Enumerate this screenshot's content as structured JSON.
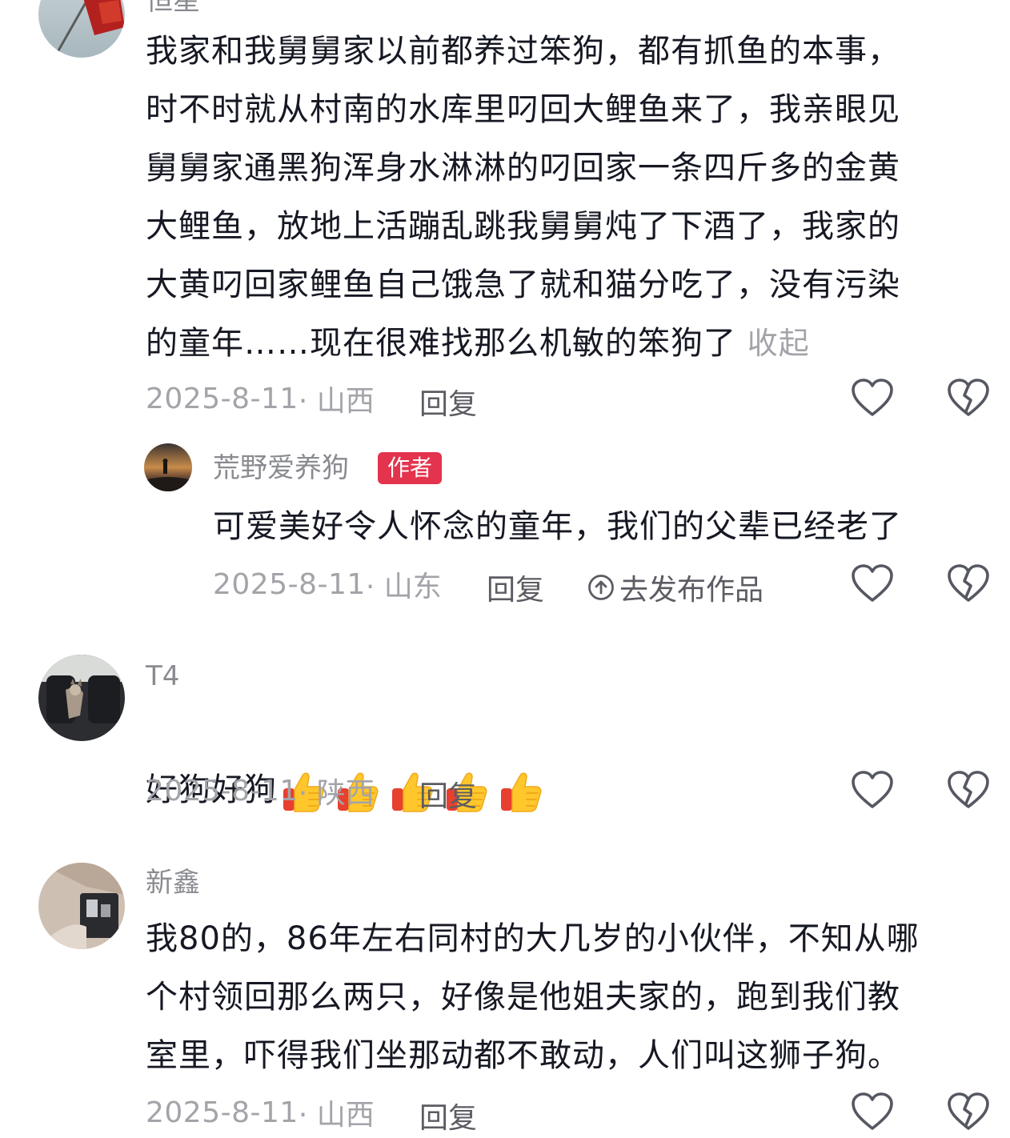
{
  "comments": [
    {
      "username": "恒星",
      "content": "我家和我舅舅家以前都养过笨狗，都有抓鱼的本事，\n时不时就从村南的水库里叼回大鲤鱼来了，我亲眼见\n舅舅家通黑狗浑身水淋淋的叼回家一条四斤多的金黄\n大鲤鱼，放地上活蹦乱跳我舅舅炖了下酒了，我家的\n大黄叼回家鲤鱼自己饿急了就和猫分吃了，没有污染\n的童年……现在很难找那么机敏的笨狗了",
      "collapse_label": "收起",
      "date": "2025-8-11",
      "location": "· 山西",
      "reply_label": "回复",
      "replies": [
        {
          "username": "荒野爱养狗",
          "badge": "作者",
          "content": "可爱美好令人怀念的童年，我们的父辈已经老了",
          "date": "2025-8-11",
          "location": "· 山东",
          "reply_label": "回复",
          "publish_label": "去发布作品"
        }
      ]
    },
    {
      "username": "T4",
      "content": "好狗好狗",
      "emoji_count": 5,
      "date": "2025-8-11",
      "location": "· 陕西",
      "reply_label": "回复"
    },
    {
      "username": "新鑫",
      "content": "我80的，86年左右同村的大几岁的小伙伴，不知从哪\n个村领回那么两只，好像是他姐夫家的，跑到我们教\n室里，吓得我们坐那动都不敢动，人们叫这狮子狗。",
      "date": "2025-8-11",
      "location": "· 山西",
      "reply_label": "回复"
    }
  ],
  "colors": {
    "text": "#161823",
    "muted": "#a3a4a9",
    "username": "#8a8b91",
    "badge": "#e4334d"
  },
  "icons": [
    "heart-outline-icon",
    "broken-heart-icon",
    "upload-circle-icon",
    "thumbs-up-emoji"
  ]
}
